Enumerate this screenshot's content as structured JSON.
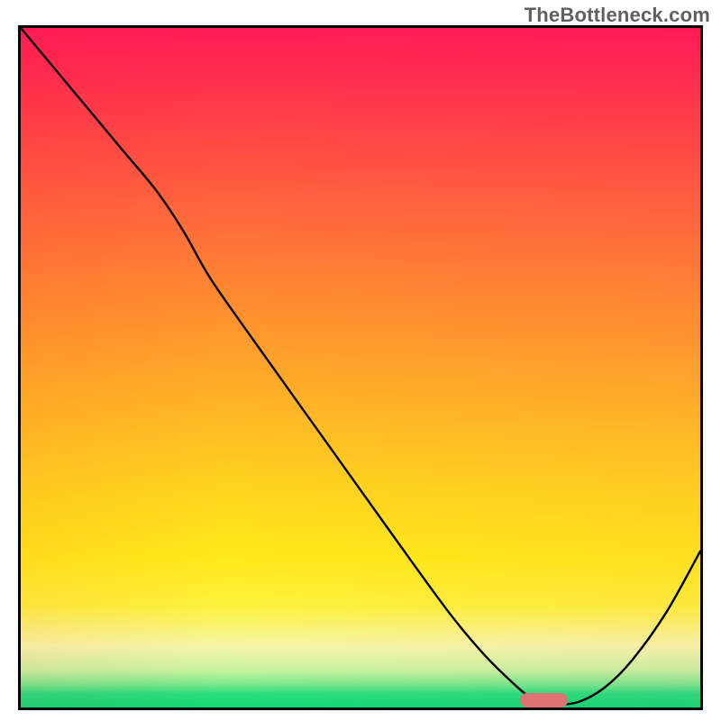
{
  "watermark": "TheBottleneck.com",
  "chart_data": {
    "type": "line",
    "title": "",
    "xlabel": "",
    "ylabel": "",
    "xlim": [
      0,
      100
    ],
    "ylim": [
      0,
      100
    ],
    "grid": false,
    "legend": false,
    "note": "Curve read off against full plot extent treated as 0–100 on both axes. y is bottleneck-style metric: high at left, falling to ~0 near x≈77, rising again toward right edge. Background is a vertical heatmap gradient from red (top) through orange/yellow to green (bottom).",
    "series": [
      {
        "name": "bottleneck-curve",
        "x": [
          0,
          5,
          10,
          15,
          20,
          24,
          28,
          35,
          45,
          55,
          63,
          68,
          72,
          75,
          78,
          82,
          86,
          90,
          95,
          100
        ],
        "y": [
          100,
          94,
          88,
          82,
          76,
          70,
          63,
          53,
          39,
          25,
          14,
          8,
          4,
          1.5,
          0.5,
          0.8,
          3,
          7,
          14,
          23
        ]
      }
    ],
    "marker": {
      "x": 77,
      "y": 1,
      "width_pct": 7,
      "label": "optimal-zone"
    },
    "gradient_stops": [
      {
        "pct": 0,
        "color": "#ff1c54"
      },
      {
        "pct": 28,
        "color": "#ff6a3b"
      },
      {
        "pct": 55,
        "color": "#ffb326"
      },
      {
        "pct": 78,
        "color": "#ffe91a"
      },
      {
        "pct": 94,
        "color": "#c9f3a0"
      },
      {
        "pct": 100,
        "color": "#11d873"
      }
    ]
  }
}
